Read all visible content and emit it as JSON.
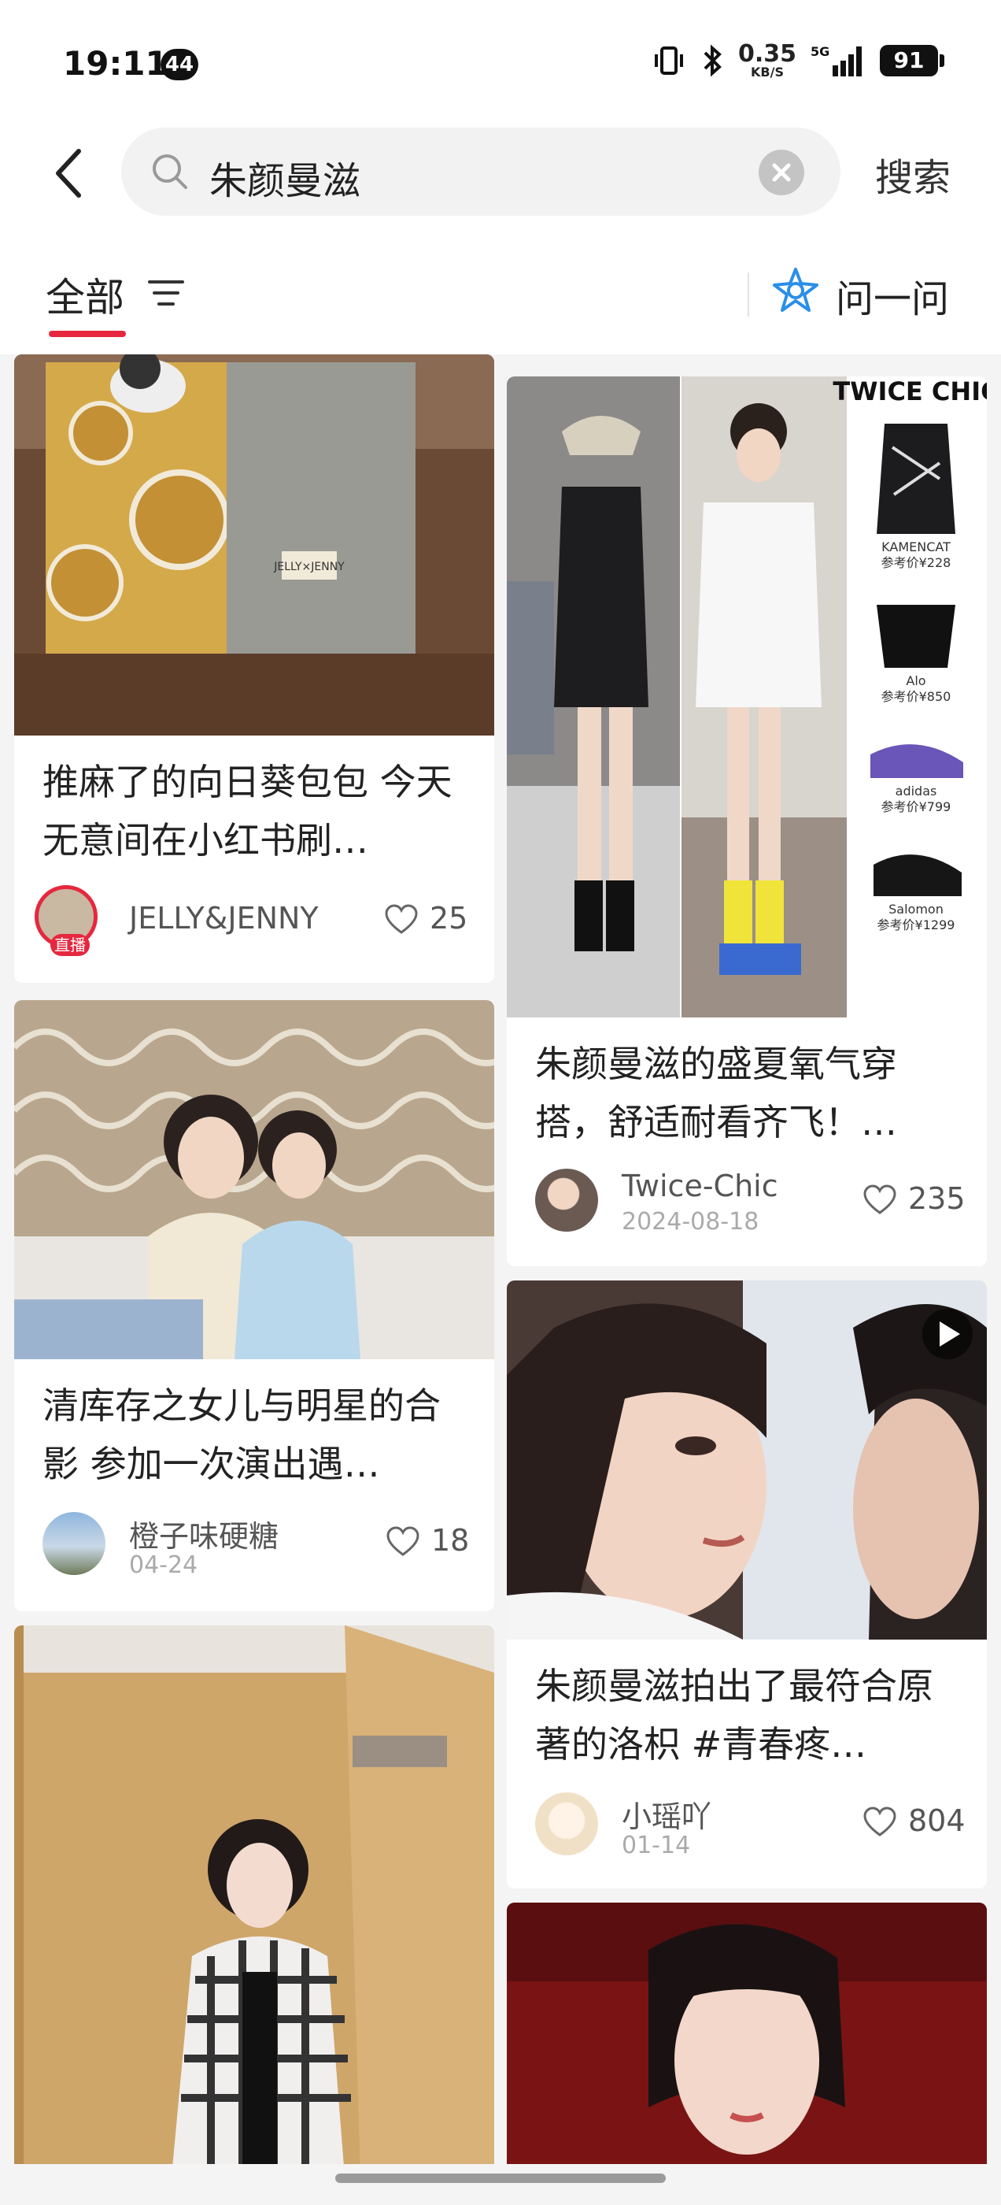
{
  "status_bar": {
    "time": "19:11",
    "notification_count": "44",
    "net_speed_value": "0.35",
    "net_speed_unit": "KB/S",
    "network": "5G",
    "battery": "91"
  },
  "search": {
    "query": "朱颜曼滋",
    "search_button": "搜索"
  },
  "filter_bar": {
    "tab_all": "全部",
    "ask_label": "问一问",
    "accent_color": "#e6273e"
  },
  "feed": {
    "left": [
      {
        "title": "推麻了的向日葵包包 今天无意间在小红书刷…",
        "author": "JELLY&JENNY",
        "live_badge": "直播",
        "likes": "25",
        "image_labels": [
          "JELLY×JENNY"
        ]
      },
      {
        "title": "清库存之女儿与明星的合影 参加一次演出遇…",
        "author": "橙子味硬糖",
        "date": "04-24",
        "likes": "18"
      },
      {
        "title": "",
        "author": "",
        "likes": ""
      }
    ],
    "right": [
      {
        "title": "朱颜曼滋的盛夏氧气穿搭，舒适耐看齐飞！…",
        "author": "Twice-Chic",
        "date": "2024-08-18",
        "likes": "235",
        "image_brand": "TWICE CHIC",
        "products": [
          {
            "name": "KAMENCAT",
            "price": "参考价¥228"
          },
          {
            "name": "Alo",
            "price": "参考价¥850"
          },
          {
            "name": "adidas",
            "price": "参考价¥799"
          },
          {
            "name": "Salomon",
            "price": "参考价¥1299"
          }
        ]
      },
      {
        "title": "朱颜曼滋拍出了最符合原著的洛枳 #青春疼…",
        "author": "小瑶吖",
        "date": "01-14",
        "likes": "804",
        "is_video": true
      },
      {
        "title": "",
        "author": "",
        "likes": ""
      }
    ]
  }
}
